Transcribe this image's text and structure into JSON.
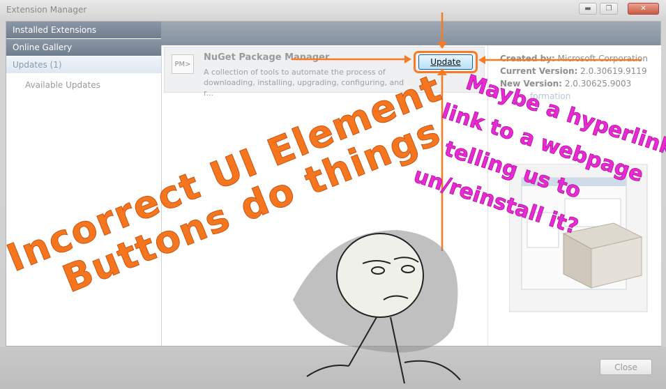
{
  "window": {
    "title": "Extension Manager"
  },
  "sidebar": {
    "items": [
      {
        "label": "Installed Extensions"
      },
      {
        "label": "Online Gallery"
      },
      {
        "label": "Updates (1)"
      }
    ],
    "sub_item": "Available Updates"
  },
  "extension": {
    "icon_text": "PM>",
    "name": "NuGet Package Manager",
    "description_line1": "A collection of tools to automate the process of",
    "description_line2": "downloading, installing, upgrading, configuring, and r...",
    "update_label": "Update"
  },
  "details": {
    "created_by_label": "Created by:",
    "created_by_value": "Microsoft Corporation",
    "current_version_label": "Current Version:",
    "current_version_value": "2.0.30619.9119",
    "new_version_label": "New Version:",
    "new_version_value": "2.0.30625.9003",
    "more_info": "formation"
  },
  "footer": {
    "close_label": "Close"
  },
  "annotations": {
    "orange_line1": "Incorrect UI Element",
    "orange_line2": "Buttons do things",
    "pink_line1": "Maybe a hyperlink",
    "pink_line2": "link to a webpage",
    "pink_line3": "telling us to",
    "pink_line4": "un/reinstall it?"
  },
  "colors": {
    "annotation_orange": "#f5761f",
    "annotation_pink": "#e52bd1",
    "sidebar_header": "#7a8898"
  }
}
